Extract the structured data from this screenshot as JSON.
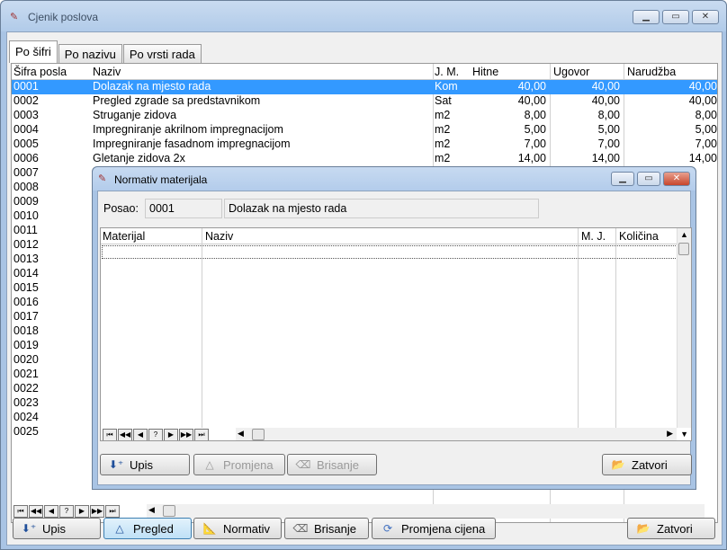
{
  "window": {
    "title": "Cjenik poslova",
    "min_icon": "minimize-icon",
    "max_icon": "maximize-icon",
    "close_icon": "close-icon"
  },
  "tabs": [
    {
      "label": "Po šifri",
      "active": true
    },
    {
      "label": "Po nazivu",
      "active": false
    },
    {
      "label": "Po vrsti rada",
      "active": false
    }
  ],
  "grid": {
    "headers": [
      "Šifra posla",
      "Naziv",
      "J. M.",
      "Hitne",
      "Ugovor",
      "Narudžba"
    ],
    "rows": [
      {
        "sifra": "0001",
        "naziv": "Dolazak na mjesto rada",
        "jm": "Kom",
        "hitne": "40,00",
        "ugovor": "40,00",
        "narudzba": "40,00",
        "selected": true
      },
      {
        "sifra": "0002",
        "naziv": "Pregled zgrade sa predstavnikom",
        "jm": "Sat",
        "hitne": "40,00",
        "ugovor": "40,00",
        "narudzba": "40,00"
      },
      {
        "sifra": "0003",
        "naziv": "Struganje zidova",
        "jm": "m2",
        "hitne": "8,00",
        "ugovor": "8,00",
        "narudzba": "8,00"
      },
      {
        "sifra": "0004",
        "naziv": "Impregniranje akrilnom impregnacijom",
        "jm": "m2",
        "hitne": "5,00",
        "ugovor": "5,00",
        "narudzba": "5,00"
      },
      {
        "sifra": "0005",
        "naziv": "Impregniranje fasadnom impregnacijom",
        "jm": "m2",
        "hitne": "7,00",
        "ugovor": "7,00",
        "narudzba": "7,00"
      },
      {
        "sifra": "0006",
        "naziv": "Gletanje zidova 2x",
        "jm": "m2",
        "hitne": "14,00",
        "ugovor": "14,00",
        "narudzba": "14,00"
      },
      {
        "sifra": "0007"
      },
      {
        "sifra": "0008"
      },
      {
        "sifra": "0009"
      },
      {
        "sifra": "0010"
      },
      {
        "sifra": "0011"
      },
      {
        "sifra": "0012"
      },
      {
        "sifra": "0013"
      },
      {
        "sifra": "0014"
      },
      {
        "sifra": "0015"
      },
      {
        "sifra": "0016"
      },
      {
        "sifra": "0017"
      },
      {
        "sifra": "0018"
      },
      {
        "sifra": "0019"
      },
      {
        "sifra": "0020"
      },
      {
        "sifra": "0021"
      },
      {
        "sifra": "0022"
      },
      {
        "sifra": "0023"
      },
      {
        "sifra": "0024"
      },
      {
        "sifra": "0025"
      }
    ]
  },
  "nav_buttons": [
    "⏮",
    "◀◀",
    "◀",
    "?",
    "▶",
    "▶▶",
    "⏭"
  ],
  "toolbar": {
    "upis": "Upis",
    "pregled": "Pregled",
    "normativ": "Normativ",
    "brisanje": "Brisanje",
    "promjena_cijena": "Promjena cijena",
    "zatvori": "Zatvori"
  },
  "dialog": {
    "title": "Normativ materijala",
    "posao_label": "Posao:",
    "posao_sifra": "0001",
    "posao_naziv": "Dolazak na mjesto rada",
    "headers": [
      "Materijal",
      "Naziv",
      "M. J.",
      "Količina"
    ],
    "buttons": {
      "upis": "Upis",
      "promjena": "Promjena",
      "brisanje": "Brisanje",
      "zatvori": "Zatvori"
    }
  }
}
